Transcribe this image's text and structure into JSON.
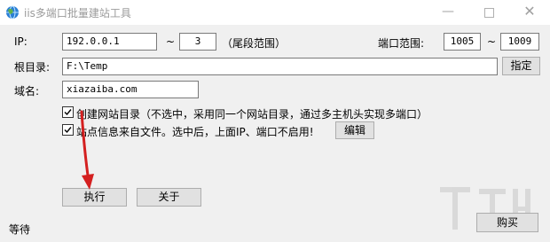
{
  "window": {
    "title": "iis多端口批量建站工具",
    "minimize_glyph": "—",
    "close_glyph": "✕"
  },
  "form": {
    "ip_label": "IP:",
    "ip_value": "192.0.0.1",
    "range_sep": "~",
    "ip_end_value": "3",
    "ip_end_hint": "（尾段范围）",
    "port_label": "端口范围:",
    "port_start": "1005",
    "port_sep": "~",
    "port_end": "1009",
    "root_label": "根目录:",
    "root_value": "F:\\Temp",
    "browse_button": "指定",
    "domain_label": "域名:",
    "domain_value": "xiazaiba.com"
  },
  "options": {
    "create_dir_label": "创建网站目录（不选中，采用同一个网站目录，通过多主机头实现多端口）",
    "create_dir_checked": true,
    "from_file_label": "站点信息来自文件。选中后，上面IP、端口不启用!",
    "from_file_checked": true,
    "edit_button": "编辑"
  },
  "actions": {
    "run_button": "执行",
    "about_button": "关于",
    "buy_button": "购买"
  },
  "status": {
    "text": "等待"
  },
  "colors": {
    "arrow": "#d42020",
    "window_bg": "#f0f0f0"
  }
}
